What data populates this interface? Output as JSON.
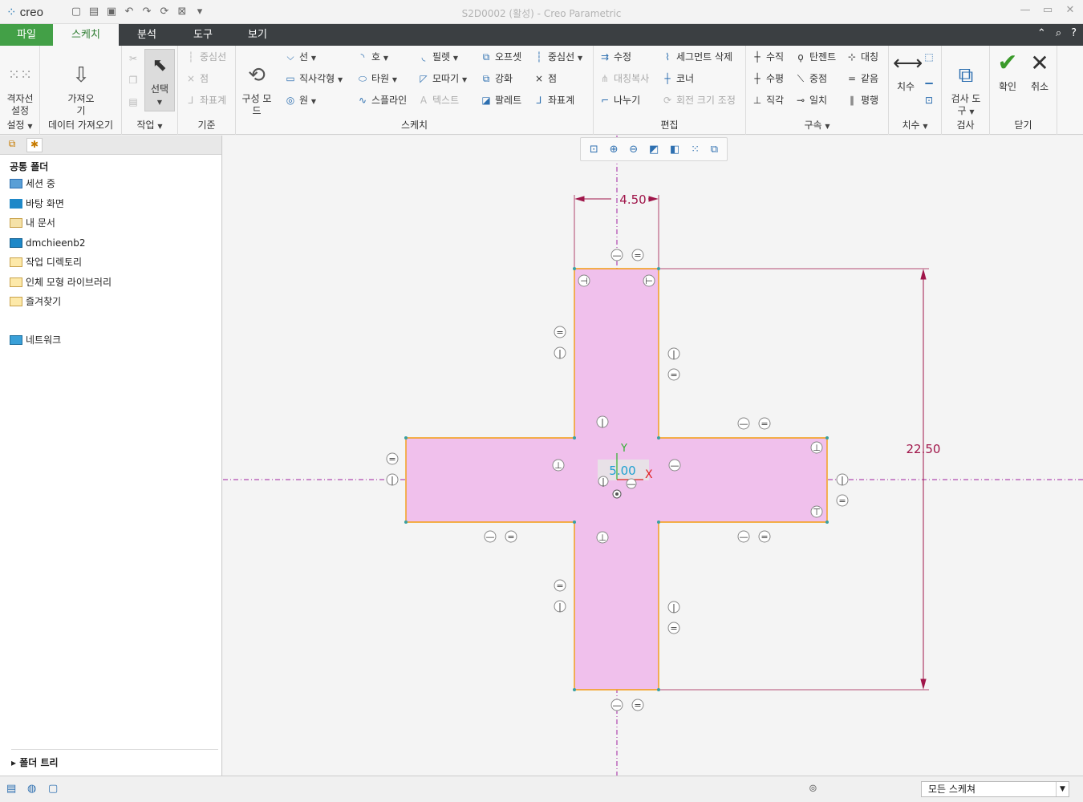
{
  "window": {
    "title": "S2D0002 (활성) - Creo Parametric",
    "app": "creo"
  },
  "qat": [
    "new-icon",
    "open-icon",
    "save-icon",
    "undo-icon",
    "redo-icon",
    "regen-icon",
    "close-window-icon",
    "customize-icon"
  ],
  "tabs": [
    {
      "label": "파일"
    },
    {
      "label": "스케치"
    },
    {
      "label": "분석"
    },
    {
      "label": "도구"
    },
    {
      "label": "보기"
    }
  ],
  "ribbon": {
    "setup": {
      "grid": "격자선\n설정",
      "label": "설정"
    },
    "import": {
      "btn": "가져오\n기",
      "label": "데이터 가져오기"
    },
    "ops": {
      "select": "선택",
      "label": "작업"
    },
    "datum": {
      "centerline": "중심선",
      "point": "점",
      "coord": "좌표계",
      "label": "기준"
    },
    "sketch": {
      "construct": "구성 모\n드",
      "line": "선",
      "rect": "직사각형",
      "circle": "원",
      "arc": "호",
      "ellipse": "타원",
      "spline": "스플라인",
      "fillet": "필렛",
      "chamfer": "모따기",
      "text": "텍스트",
      "offset": "오프셋",
      "thicken": "강화",
      "palette": "팔레트",
      "centerline": "중심선",
      "point": "점",
      "coord": "좌표계",
      "label": "스케치"
    },
    "edit": {
      "modify": "수정",
      "delete_seg": "세그먼트 삭제",
      "mirror": "대칭복사",
      "corner": "코너",
      "divide": "나누기",
      "rotate_resize": "회전 크기 조정",
      "label": "편집"
    },
    "constrain": {
      "vertical": "수직",
      "tangent": "탄젠트",
      "symmetric": "대칭",
      "horizontal": "수평",
      "midpoint": "중점",
      "equal": "같음",
      "perpendicular": "직각",
      "coincident": "일치",
      "parallel": "평행",
      "label": "구속"
    },
    "dimension": {
      "dim": "치수",
      "label": "치수"
    },
    "inspect": {
      "tool": "검사 도\n구",
      "label": "검사"
    },
    "close": {
      "ok": "확인",
      "cancel": "취소",
      "label": "닫기"
    }
  },
  "navigator": {
    "heading": "공통 폴더",
    "items": [
      "세션 중",
      "바탕 화면",
      "내 문서",
      "dmchieenb2",
      "작업 디렉토리",
      "인체 모형 라이브러리",
      "즐겨찾기",
      "네트워크"
    ],
    "folder_tree": "폴더 트리"
  },
  "sketch": {
    "dim_width": "4.50",
    "dim_height": "22.50",
    "center_dim": "5.00",
    "x_axis": "X",
    "y_axis": "Y",
    "fill": "#f0c0ec",
    "edge": "#f39c12",
    "dim_color": "#a0164a"
  },
  "status": {
    "filter": "모든 스케쳐"
  }
}
